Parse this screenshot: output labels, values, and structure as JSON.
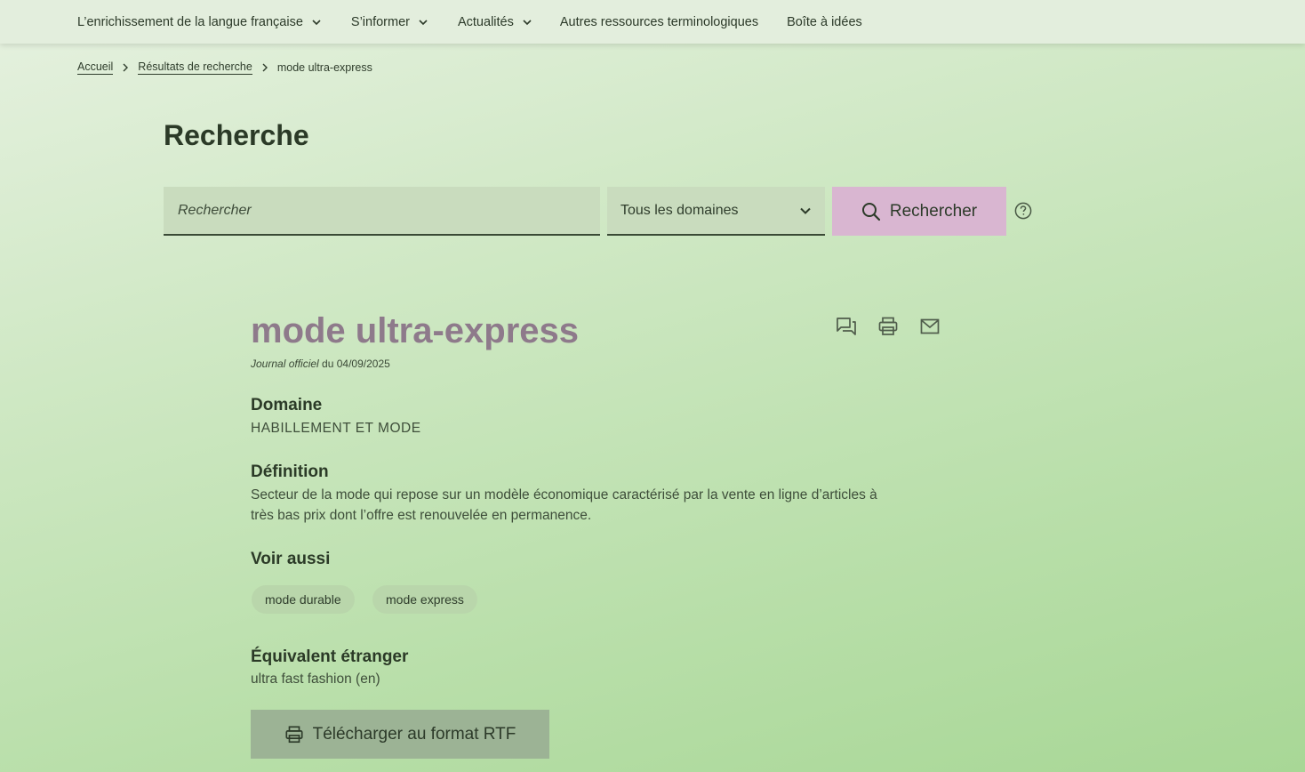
{
  "nav": {
    "items": [
      {
        "label": "L’enrichissement de la langue française",
        "dropdown": true
      },
      {
        "label": "S’informer",
        "dropdown": true
      },
      {
        "label": "Actualités",
        "dropdown": true
      },
      {
        "label": "Autres ressources terminologiques",
        "dropdown": false
      },
      {
        "label": "Boîte à idées",
        "dropdown": false
      }
    ]
  },
  "breadcrumb": {
    "home": "Accueil",
    "results": "Résultats de recherche",
    "current": "mode ultra-express"
  },
  "page": {
    "title": "Recherche"
  },
  "search": {
    "placeholder": "Rechercher",
    "domain_selected": "Tous les domaines",
    "button_label": "Rechercher"
  },
  "term": {
    "title": "mode ultra-express",
    "journal_label": "Journal officiel",
    "journal_date": " du 04/09/2025",
    "domain_heading": "Domaine",
    "domain_value": "HABILLEMENT ET MODE",
    "definition_heading": "Définition",
    "definition_line1": "Secteur de la mode qui repose sur un modèle économique caractérisé par la vente en ligne d’articles à",
    "definition_line2": "très bas prix dont l’offre est renouvelée en permanence.",
    "see_also_heading": "Voir aussi",
    "see_also": [
      "mode durable",
      "mode express"
    ],
    "foreign_heading": "Équivalent étranger",
    "foreign_value": "ultra fast fashion (en)",
    "download_label": "Télécharger au format RTF"
  },
  "icons": [
    "chevron-down-icon",
    "chevron-right-icon",
    "search-icon",
    "help-icon",
    "comment-icon",
    "print-icon",
    "mail-icon"
  ],
  "colors": {
    "accent_button": "#d9b6d1",
    "term_title": "#8e7a8b",
    "download_button": "#9cb395"
  }
}
